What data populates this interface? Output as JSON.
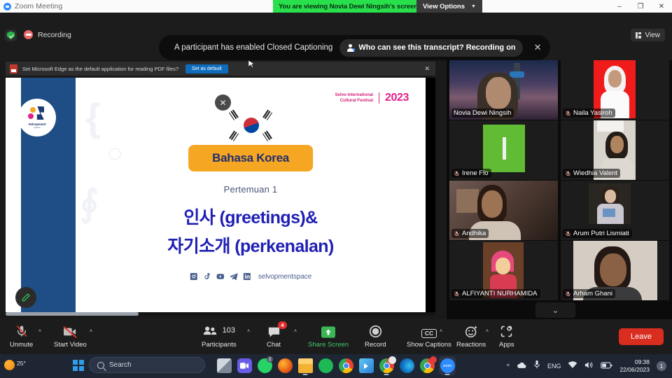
{
  "window": {
    "title": "Zoom Meeting",
    "viewing_banner": "You are viewing Novia Dewi Ningsih's screen",
    "view_options_label": "View Options",
    "minimize_glyph": "–",
    "maximize_glyph": "❐",
    "close_glyph": "✕"
  },
  "status_bar": {
    "recording_label": "Recording",
    "view_button_label": "View",
    "encryption_icon": "shield-check-icon"
  },
  "cc_toast": {
    "message": "A participant has enabled Closed Captioning",
    "pill_text": "Who can see this transcript? Recording on",
    "close_glyph": "✕"
  },
  "edge_notification": {
    "text": "Set Microsoft Edge as the default application for reading PDF files?",
    "button_label": "Set as default",
    "close_glyph": "✕"
  },
  "slide": {
    "logo_title": "Selvopment",
    "logo_subtitle": "space",
    "festival_name_line1": "Selvo International",
    "festival_name_line2": "Cultural Festival",
    "festival_year": "2023",
    "title_badge": "Bahasa Korea",
    "session": "Pertemuan 1",
    "heading_line1": "인사 (greetings)&",
    "heading_line2": "자기소개 (perkenalan)",
    "social_handle": "selvopmentspace",
    "socials": [
      "instagram-icon",
      "tiktok-icon",
      "youtube-icon",
      "telegram-icon",
      "linkedin-icon"
    ],
    "close_glyph": "✕",
    "flag": "south-korea-flag",
    "annotate_icon": "pen-icon"
  },
  "participants": [
    {
      "name": "Novia Dewi Ningsih",
      "muted": false,
      "active_speaker": true
    },
    {
      "name": "Naila Yasiroh",
      "muted": true,
      "active_speaker": false
    },
    {
      "name": "Irene Flo",
      "muted": true,
      "active_speaker": false
    },
    {
      "name": "Wiedhia Valent",
      "muted": true,
      "active_speaker": false
    },
    {
      "name": "Andhika",
      "muted": true,
      "active_speaker": false
    },
    {
      "name": "Arum Putri Lismiati",
      "muted": true,
      "active_speaker": false
    },
    {
      "name": "ALFIYANTI NURHAMIDA",
      "muted": true,
      "active_speaker": false
    },
    {
      "name": "Arham Ghani",
      "muted": true,
      "active_speaker": false
    }
  ],
  "panel": {
    "scroll_down_glyph": "⌄"
  },
  "toolbar": {
    "unmute_label": "Unmute",
    "start_video_label": "Start Video",
    "participants_label": "Participants",
    "participants_count": "103",
    "chat_label": "Chat",
    "chat_badge": "4",
    "share_screen_label": "Share Screen",
    "record_label": "Record",
    "show_captions_label": "Show Captions",
    "captions_glyph": "CC",
    "reactions_label": "Reactions",
    "apps_label": "Apps",
    "leave_label": "Leave",
    "caret_glyph": "˄"
  },
  "taskbar": {
    "weather_temp": "25°",
    "search_placeholder": "Search",
    "start_icon": "windows-start-icon",
    "apps": [
      {
        "name": "task-view",
        "badge": ""
      },
      {
        "name": "zoom",
        "badge": ""
      },
      {
        "name": "whatsapp",
        "badge": "2"
      },
      {
        "name": "firefox",
        "badge": ""
      },
      {
        "name": "file-explorer",
        "badge": ""
      },
      {
        "name": "spotify",
        "badge": ""
      },
      {
        "name": "chrome",
        "badge": ""
      },
      {
        "name": "media-player",
        "badge": ""
      },
      {
        "name": "chrome",
        "badge": ""
      },
      {
        "name": "edge",
        "badge": ""
      },
      {
        "name": "chrome",
        "badge": ""
      },
      {
        "name": "zoom",
        "badge": ""
      }
    ],
    "tray_language": "ENG",
    "clock_time": "09:38",
    "clock_date": "22/06/2023",
    "notification_count": "1"
  },
  "colors": {
    "accent_green": "#28e04b",
    "leave_red": "#d92d20",
    "share_green": "#45c669",
    "slide_badge": "#f5a623",
    "slide_heading": "#1f1fb5",
    "festival_pink": "#e0218a"
  }
}
